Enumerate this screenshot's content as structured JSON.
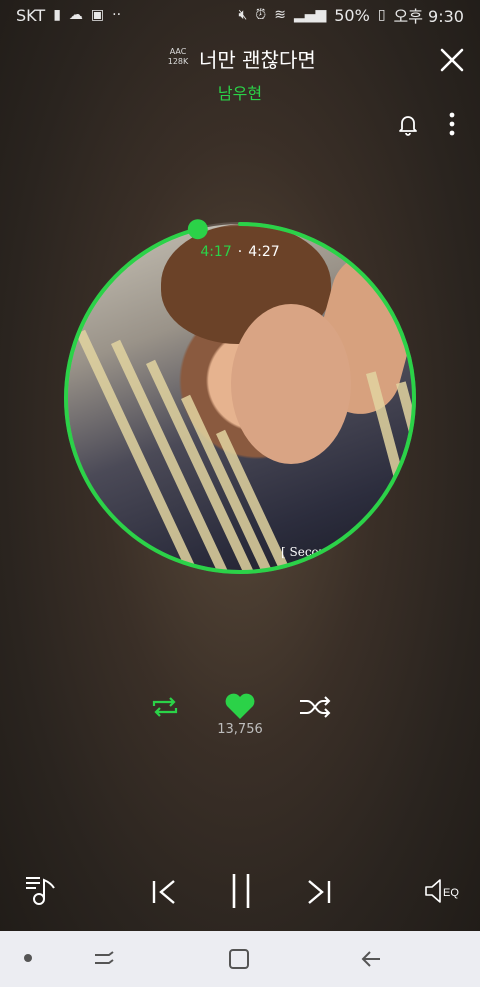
{
  "status_bar": {
    "carrier": "SKT",
    "battery": "50%",
    "time": "오후 9:30"
  },
  "header": {
    "quality_line1": "AAC",
    "quality_line2": "128K",
    "song_title": "너만 괜찮다면",
    "artist": "남우현"
  },
  "player": {
    "elapsed": "4:17",
    "duration": "4:27",
    "progress_fraction": 0.961,
    "album_cover_text": "[ Secon",
    "likes": "13,756"
  },
  "colors": {
    "accent": "#2bd248"
  },
  "icons": {
    "close": "close-icon",
    "bell": "bell-icon",
    "more": "more-vertical-icon",
    "repeat": "repeat-icon",
    "heart": "heart-icon",
    "shuffle": "shuffle-icon",
    "playlist": "playlist-icon",
    "previous": "previous-icon",
    "pause": "pause-icon",
    "next": "next-icon",
    "equalizer": "equalizer-icon"
  }
}
